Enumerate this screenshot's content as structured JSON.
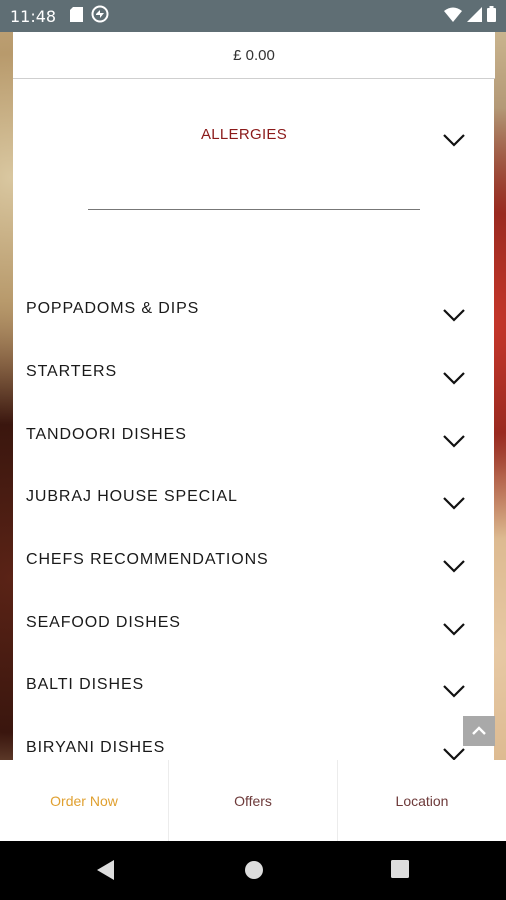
{
  "status_bar": {
    "time": "11:48",
    "icons_left": [
      "sd-card-icon",
      "vpn-icon"
    ],
    "icons_right": [
      "wifi-icon",
      "signal-icon",
      "battery-icon"
    ]
  },
  "cart": {
    "total": "£ 0.00"
  },
  "menu": {
    "allergies_label": "ALLERGIES",
    "categories": [
      "POPPADOMS & DIPS",
      "STARTERS",
      "TANDOORI DISHES",
      "JUBRAJ HOUSE SPECIAL",
      "CHEFS RECOMMENDATIONS",
      "SEAFOOD DISHES",
      "BALTI DISHES",
      "BIRYANI DISHES"
    ]
  },
  "tabs": [
    {
      "label": "Order Now",
      "color": "#e0a030"
    },
    {
      "label": "Offers",
      "color": "#6d3a3a"
    },
    {
      "label": "Location",
      "color": "#6d3a3a"
    }
  ],
  "colors": {
    "allergies_text": "#8b1a1a",
    "status_bar_bg": "#5f6e74"
  }
}
